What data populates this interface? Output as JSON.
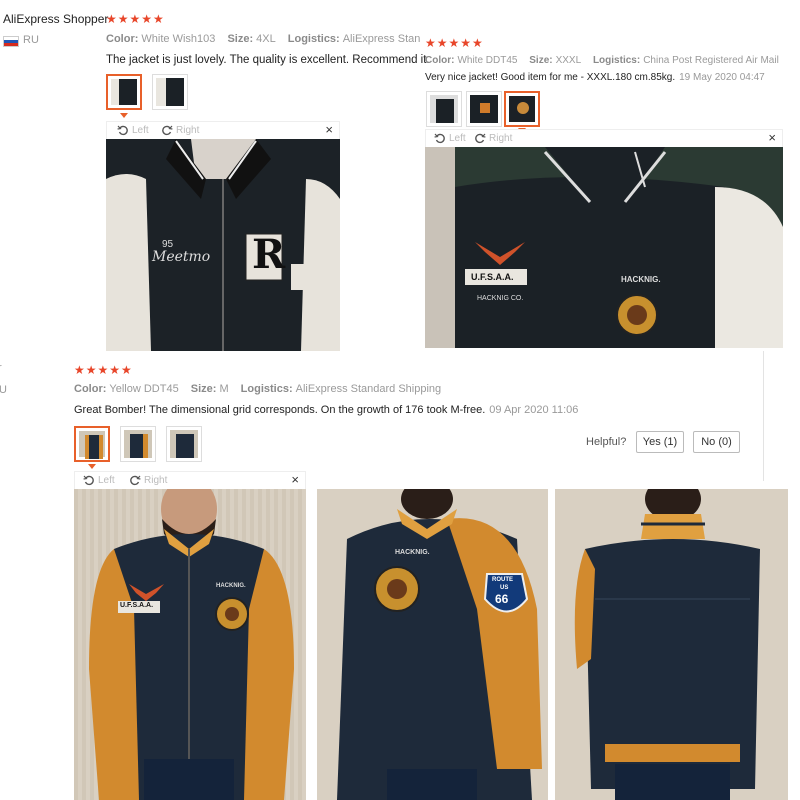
{
  "reviewer1": {
    "name": "AliExpress Shopper",
    "country": "RU",
    "stars": "★★★★★"
  },
  "review1": {
    "color_label": "Color:",
    "color": "White Wish103",
    "size_label": "Size:",
    "size": "4XL",
    "logistics_label": "Logistics:",
    "logistics": "AliExpress Standard",
    "text": "The jacket is just lovely. The quality is excellent. Recommend it."
  },
  "review2": {
    "stars": "★★★★★",
    "color_label": "Color:",
    "color": "White DDT45",
    "size_label": "Size:",
    "size": "XXXL",
    "logistics_label": "Logistics:",
    "logistics": "China Post Registered Air Mail",
    "text": "Very nice jacket! Good item for me - XXXL.180 cm.85kg.",
    "date": "19 May 2020 04:47"
  },
  "review3": {
    "stars": "★★★★★",
    "color_label": "Color:",
    "color": "Yellow DDT45",
    "size_label": "Size:",
    "size": "M",
    "logistics_label": "Logistics:",
    "logistics": "AliExpress Standard Shipping",
    "text": "Great Bomber! The dimensional grid corresponds. On the growth of 176 took M-free.",
    "date": "09 Apr 2020 11:06",
    "helpful_label": "Helpful?",
    "yes_label": "Yes (1)",
    "no_label": "No (0)"
  },
  "viewer": {
    "left_label": "Left",
    "right_label": "Right",
    "close_glyph": "×"
  },
  "edge_fragments": {
    "left_mark": "r",
    "left_u": "U"
  },
  "photo_text": {
    "patch_r": "R",
    "patch_route": "ROUTE",
    "patch_us": "US",
    "patch_66": "66",
    "ufsaa": "U.F.S.A.A.",
    "hacknig": "HACKNIG.",
    "hacknig_co": "HACKNIG CO.",
    "meetmo": "Meetmo",
    "num95": "95"
  },
  "colors": {
    "star": "#e8462a",
    "active_thumb": "#e8602a",
    "jacket_black": "#1b2126",
    "jacket_navy": "#1e2a3a",
    "sleeve_yellow": "#d28a2e",
    "sleeve_white": "#e9e6df"
  }
}
